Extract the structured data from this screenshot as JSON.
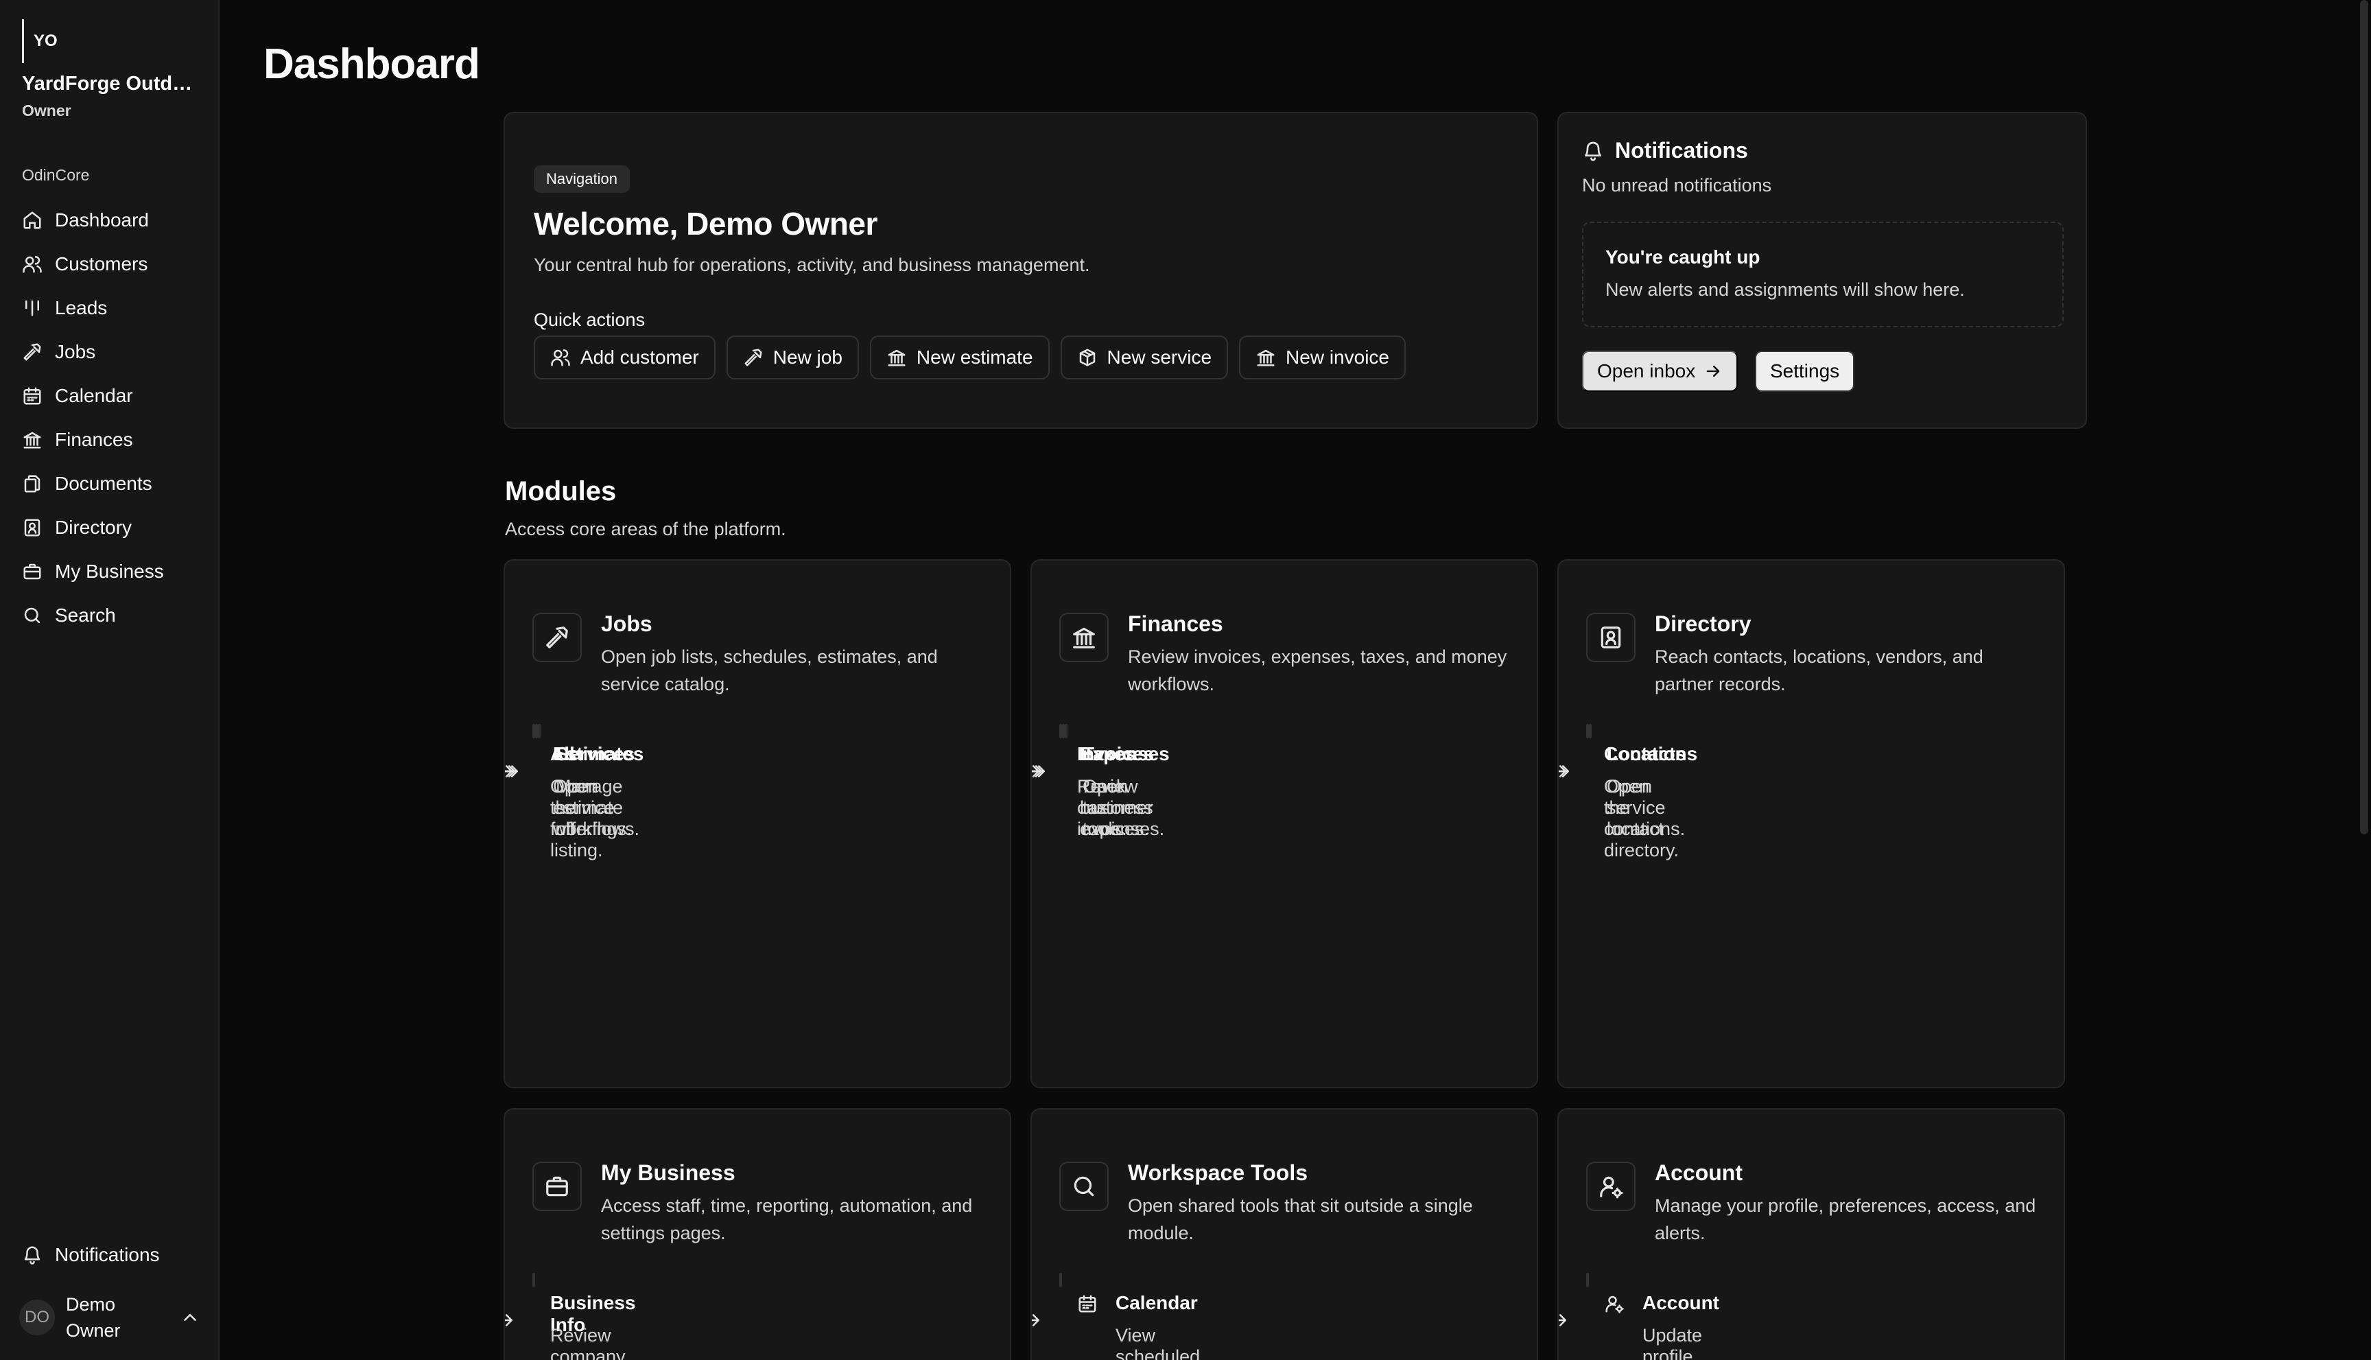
{
  "sidebar": {
    "workspace_initials": "YO",
    "workspace_name": "YardForge Outdo...",
    "workspace_role": "Owner",
    "group_label": "OdinCore",
    "items": [
      {
        "label": "Dashboard",
        "icon": "home-icon"
      },
      {
        "label": "Customers",
        "icon": "users-icon"
      },
      {
        "label": "Leads",
        "icon": "bars-icon"
      },
      {
        "label": "Jobs",
        "icon": "hammer-icon"
      },
      {
        "label": "Calendar",
        "icon": "calendar-icon"
      },
      {
        "label": "Finances",
        "icon": "bank-icon"
      },
      {
        "label": "Documents",
        "icon": "documents-icon"
      },
      {
        "label": "Directory",
        "icon": "contact-book-icon"
      },
      {
        "label": "My Business",
        "icon": "briefcase-icon"
      },
      {
        "label": "Search",
        "icon": "search-icon"
      }
    ],
    "notifications_label": "Notifications",
    "user_initials": "DO",
    "user_name": "Demo Owner"
  },
  "page": {
    "title": "Dashboard"
  },
  "welcome": {
    "chip": "Navigation",
    "title": "Welcome, Demo Owner",
    "subtitle": "Your central hub for operations, activity, and business management.",
    "quick_actions_label": "Quick actions",
    "quick_actions": [
      {
        "label": "Add customer",
        "icon": "users-icon"
      },
      {
        "label": "New job",
        "icon": "hammer-icon"
      },
      {
        "label": "New estimate",
        "icon": "bank-icon"
      },
      {
        "label": "New service",
        "icon": "box-icon"
      },
      {
        "label": "New invoice",
        "icon": "bank-icon"
      }
    ]
  },
  "notifications": {
    "title": "Notifications",
    "subtitle": "No unread notifications",
    "empty_title": "You're caught up",
    "empty_sub": "New alerts and assignments will show here.",
    "open_inbox": "Open inbox",
    "settings": "Settings"
  },
  "modules": {
    "title": "Modules",
    "subtitle": "Access core areas of the platform.",
    "cards": [
      {
        "title": "Jobs",
        "icon": "hammer-icon",
        "desc": "Open job lists, schedules, estimates, and service catalog.",
        "links": [
          {
            "title": "All",
            "desc": "Open the full listing."
          },
          {
            "title": "Estimates",
            "desc": "Open estimate workflows."
          },
          {
            "title": "Services",
            "desc": "Manage service offerings."
          }
        ]
      },
      {
        "title": "Finances",
        "icon": "bank-icon",
        "desc": "Review invoices, expenses, taxes, and money workflows.",
        "links": [
          {
            "title": "Invoices",
            "desc": "Review customer invoices."
          },
          {
            "title": "Expenses",
            "desc": "Track business expenses."
          },
          {
            "title": "Taxes",
            "desc": "Open tax tools."
          }
        ]
      },
      {
        "title": "Directory",
        "icon": "contact-book-icon",
        "desc": "Reach contacts, locations, vendors, and partner records.",
        "links": [
          {
            "title": "Contacts",
            "desc": "Open the contact directory."
          },
          {
            "title": "Locations",
            "desc": "Open service locations."
          }
        ]
      },
      {
        "title": "My Business",
        "icon": "briefcase-icon",
        "desc": "Access staff, time, reporting, automation, and settings pages.",
        "links": [
          {
            "title": "Business Info",
            "desc": "Review company profile details."
          }
        ]
      },
      {
        "title": "Workspace Tools",
        "icon": "search-icon",
        "desc": "Open shared tools that sit outside a single module.",
        "links": [
          {
            "title": "Calendar",
            "desc": "View scheduled work and",
            "icon": "calendar-icon"
          }
        ]
      },
      {
        "title": "Account",
        "icon": "user-gear-icon",
        "desc": "Manage your profile, preferences, access, and alerts.",
        "links": [
          {
            "title": "Account",
            "desc": "Update profile, preferences, security,",
            "icon": "user-gear-icon"
          }
        ]
      }
    ]
  }
}
